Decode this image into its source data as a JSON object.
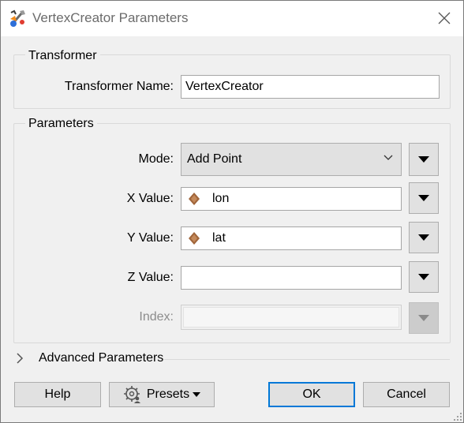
{
  "window": {
    "title": "VertexCreator Parameters",
    "icon": "fme-transformer-icon",
    "close_icon": "close-icon"
  },
  "transformer_group": {
    "title": "Transformer",
    "name_label": "Transformer Name:",
    "name_value": "VertexCreator"
  },
  "parameters_group": {
    "title": "Parameters",
    "mode_label": "Mode:",
    "mode_value": "Add Point",
    "x_label": "X Value:",
    "x_value": "lon",
    "y_label": "Y Value:",
    "y_value": "lat",
    "z_label": "Z Value:",
    "z_value": "",
    "index_label": "Index:",
    "index_value": ""
  },
  "advanced": {
    "label": "Advanced Parameters",
    "expanded": false
  },
  "buttons": {
    "help": "Help",
    "presets": "Presets",
    "ok": "OK",
    "cancel": "Cancel"
  },
  "colors": {
    "accent": "#0078d7",
    "attribute_icon": "#a0653a",
    "title_text": "#6b6b6b"
  }
}
